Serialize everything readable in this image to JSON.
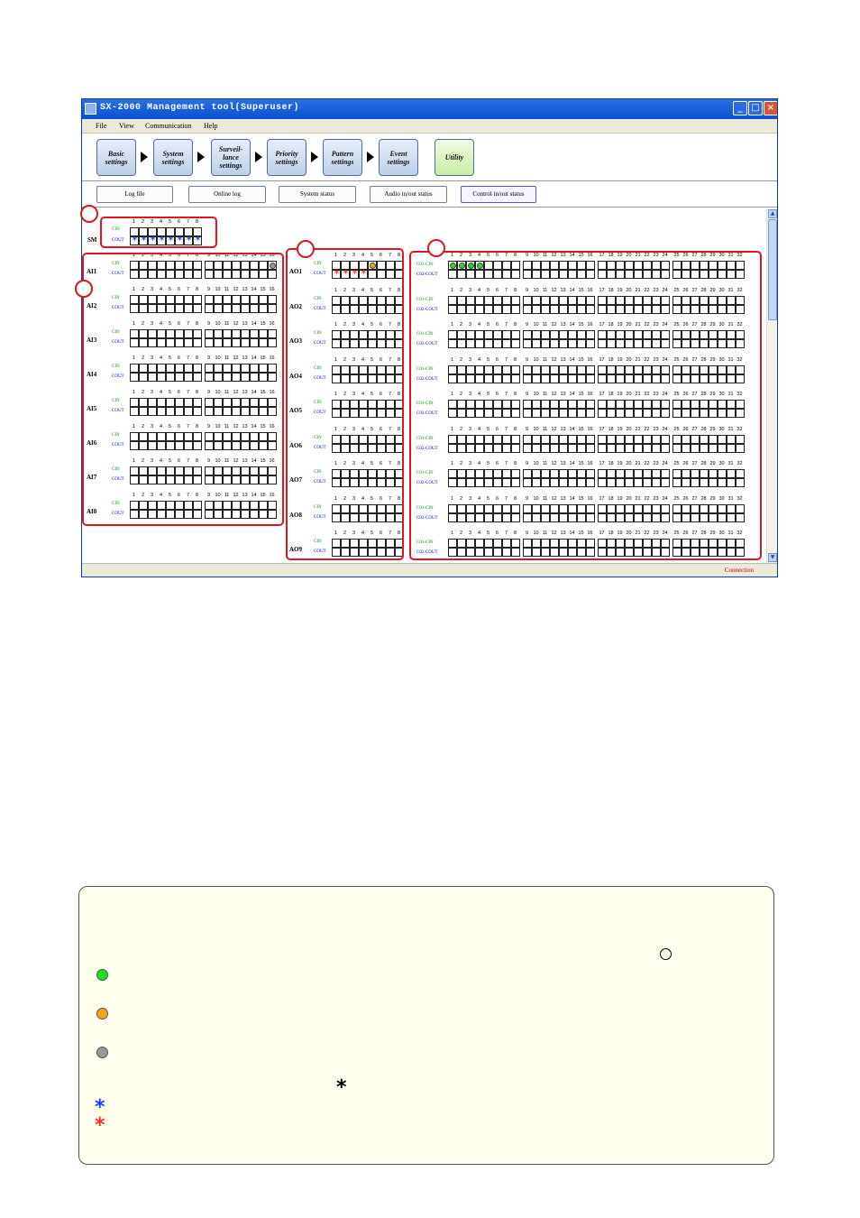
{
  "window": {
    "title": "SX-2000 Management tool(Superuser)"
  },
  "menu": [
    "File",
    "View",
    "Communication",
    "Help"
  ],
  "nav": [
    {
      "label": "Basic settings"
    },
    {
      "label": "System settings"
    },
    {
      "label": "Surveil-lance settings"
    },
    {
      "label": "Priority settings"
    },
    {
      "label": "Pattern settings"
    },
    {
      "label": "Event settings"
    },
    {
      "label": "Utility"
    }
  ],
  "subnav": [
    "Log file",
    "Online log",
    "System status",
    "Audio in/out status",
    "Control in/out status"
  ],
  "subnav_active": "Control in/out status",
  "status": {
    "connection": "Connection"
  },
  "labels": {
    "cin": "CIN",
    "cout": "COUT",
    "c01cin": "C01-CIN",
    "c02cout": "C02-COUT"
  },
  "sm": {
    "label": "SM",
    "count": 8,
    "cout_marks": [
      1,
      1,
      1,
      1,
      1,
      1,
      1,
      1
    ]
  },
  "ai_units": [
    "AI1",
    "AI2",
    "AI3",
    "AI4",
    "AI5",
    "AI6",
    "AI7",
    "AI8"
  ],
  "ao_units": [
    "AO1",
    "AO2",
    "AO3",
    "AO4",
    "AO5",
    "AO6",
    "AO7",
    "AO8",
    "AO9"
  ],
  "ai_count": 16,
  "ao_count": 8,
  "ci_count": 32,
  "ai_states": {
    "AI1": {
      "cin_dots": {
        "16": "gray"
      }
    }
  },
  "ao_states": {
    "AO1": {
      "cin_dots": {
        "5": "orange"
      },
      "cout_marks": [
        1,
        2,
        3,
        4
      ]
    }
  },
  "ci_states": {
    "0": {
      "cin_dots": {
        "1": "green",
        "2": "green",
        "3": "green",
        "4": "green"
      }
    }
  },
  "colors": {
    "green": "#22dd22",
    "orange": "#f7a21b",
    "gray": "#999999",
    "blue": "#1a3aff",
    "red": "#ff2a2a",
    "frame": "#e0161f"
  }
}
